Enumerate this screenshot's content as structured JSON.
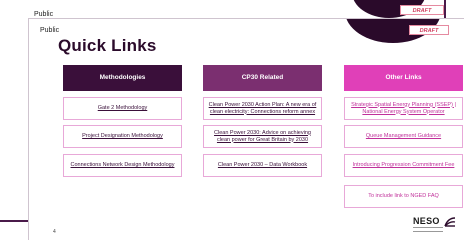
{
  "back_slide": {
    "public_label": "Public",
    "draft_label": "DRAFT"
  },
  "front_slide": {
    "public_label": "Public",
    "draft_label": "DRAFT",
    "title": "Quick Links",
    "page_number": "4"
  },
  "columns": [
    {
      "header": "Methodologies",
      "links": [
        "Gate 2 Methodology",
        "Project Designation Methodology",
        "Connections Network Design Methodology"
      ]
    },
    {
      "header": "CP30 Related",
      "links": [
        "Clean Power 2030 Action Plan: A new era of clean electricity: Connections reform annex",
        "Clean Power 2030: Advice on achieving clean power for Great Britain by 2030",
        "Clean Power 2030 – Data Workbook"
      ]
    },
    {
      "header": "Other Links",
      "links": [
        "Strategic Spatial Energy Planning (SSEP) | National Energy System Operator",
        "Queue Management Guidance",
        "Introducing Progression Commitment Fee",
        "To include link to NGED FAQ"
      ]
    }
  ],
  "brand": {
    "name": "NESO",
    "icon": "neso-logo-icon"
  },
  "colors": {
    "dark_purple": "#3a0f3a",
    "mid_purple": "#7b2f70",
    "pink": "#e040b8"
  }
}
